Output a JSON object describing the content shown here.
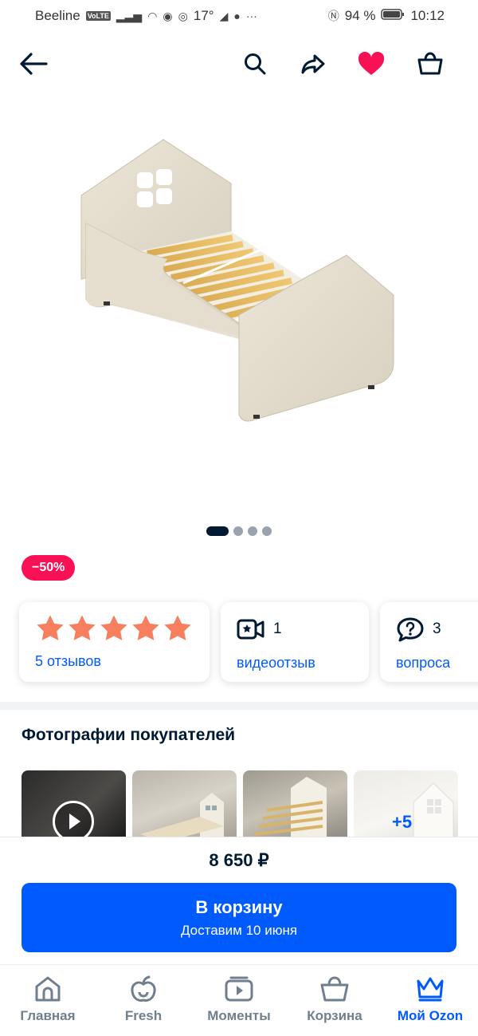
{
  "status_bar": {
    "carrier": "Beeline",
    "volte": "VoLTE",
    "temperature": "17°",
    "battery": "94 %",
    "time": "10:12"
  },
  "product": {
    "discount_badge": "−50%",
    "gallery_pages": 4,
    "gallery_active": 0
  },
  "cards": {
    "rating": {
      "stars": 5,
      "reviews_link": "5 отзывов"
    },
    "video": {
      "count": "1",
      "link": "видеоотзыв"
    },
    "questions": {
      "count": "3",
      "link": "вопроса"
    }
  },
  "customer_photos": {
    "title": "Фотографии покупателей",
    "more_label": "+5"
  },
  "buy": {
    "price": "8 650 ₽",
    "button_label": "В корзину",
    "delivery_label": "Доставим 10 июня"
  },
  "nav": {
    "home": "Главная",
    "fresh": "Fresh",
    "moments": "Моменты",
    "cart": "Корзина",
    "my_ozon": "Мой Ozon"
  },
  "colors": {
    "accent": "#005bff",
    "favorite": "#f91155",
    "star": "#f87f5d"
  }
}
